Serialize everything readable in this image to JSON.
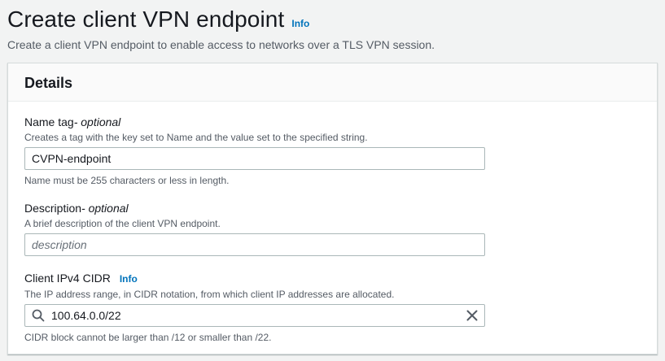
{
  "header": {
    "title": "Create client VPN endpoint",
    "info_label": "Info",
    "description": "Create a client VPN endpoint to enable access to networks over a TLS VPN session."
  },
  "details": {
    "title": "Details",
    "name_tag": {
      "label": "Name tag",
      "optional_suffix": " - optional",
      "description": "Creates a tag with the key set to Name and the value set to the specified string.",
      "value": "CVPN-endpoint",
      "constraint": "Name must be 255 characters or less in length."
    },
    "description_field": {
      "label": "Description",
      "optional_suffix": " - optional",
      "description": "A brief description of the client VPN endpoint.",
      "value": "",
      "placeholder": "description"
    },
    "client_cidr": {
      "label": "Client IPv4 CIDR",
      "info_label": "Info",
      "description": "The IP address range, in CIDR notation, from which client IP addresses are allocated.",
      "value": "100.64.0.0/22",
      "constraint": "CIDR block cannot be larger than /12 or smaller than /22."
    }
  },
  "icons": {
    "search": "search-icon",
    "clear": "close-icon"
  },
  "colors": {
    "background": "#f2f3f3",
    "link": "#0073bb",
    "text": "#16191f",
    "secondary_text": "#545b64",
    "input_border": "#aab7b8"
  }
}
